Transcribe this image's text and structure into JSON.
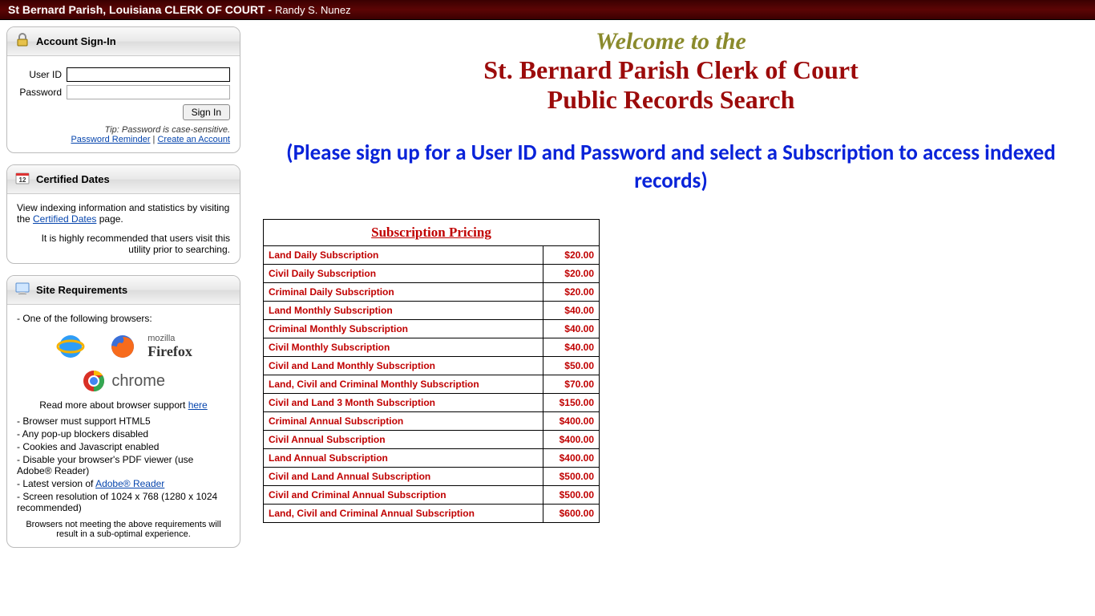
{
  "header": {
    "title": "St Bernard Parish, Louisiana CLERK OF COURT - ",
    "subtitle": "Randy S. Nunez"
  },
  "signin_panel": {
    "title": "Account Sign-In",
    "user_label": "User ID",
    "password_label": "Password",
    "button": "Sign In",
    "tip": "Tip: Password is case-sensitive.",
    "reminder_link": "Password Reminder",
    "separator": " | ",
    "create_link": "Create an Account"
  },
  "certified_panel": {
    "title": "Certified Dates",
    "text_pre": "View indexing information and statistics by visiting the ",
    "link": "Certified Dates",
    "text_post": " page.",
    "recommend": "It is highly recommended that users visit this utility prior to searching."
  },
  "requirements_panel": {
    "title": "Site Requirements",
    "intro": "- One of the following browsers:",
    "firefox_small": "mozilla",
    "firefox_big": "Firefox",
    "chrome_label": "chrome",
    "support_text": "Read more about browser support ",
    "support_link": "here",
    "items": [
      "- Browser must support HTML5",
      "- Any pop-up blockers disabled",
      "- Cookies and Javascript enabled",
      "- Disable your browser's PDF viewer (use Adobe® Reader)",
      "- Latest version of ",
      "- Screen resolution of 1024 x 768 (1280 x 1024 recommended)"
    ],
    "adobe_link": "Adobe® Reader",
    "note": "Browsers not meeting the above requirements will result in a sub-optimal experience."
  },
  "welcome": {
    "pre": "Welcome to the",
    "line1": "St. Bernard Parish Clerk of Court",
    "line2": "Public Records Search"
  },
  "signup_note": "(Please sign up for a User ID and Password and select a Subscription to access indexed records)",
  "pricing": {
    "heading": "Subscription Pricing",
    "rows": [
      {
        "name": "Land Daily Subscription",
        "price": "$20.00"
      },
      {
        "name": "Civil Daily Subscription",
        "price": "$20.00"
      },
      {
        "name": "Criminal Daily Subscription",
        "price": "$20.00"
      },
      {
        "name": "Land Monthly Subscription",
        "price": "$40.00"
      },
      {
        "name": "Criminal Monthly Subscription",
        "price": "$40.00"
      },
      {
        "name": "Civil Monthly Subscription",
        "price": "$40.00"
      },
      {
        "name": "Civil and Land Monthly Subscription",
        "price": "$50.00"
      },
      {
        "name": "Land, Civil and Criminal Monthly Subscription",
        "price": "$70.00"
      },
      {
        "name": "Civil and Land 3 Month Subscription",
        "price": "$150.00"
      },
      {
        "name": "Criminal Annual Subscription",
        "price": "$400.00"
      },
      {
        "name": "Civil Annual Subscription",
        "price": "$400.00"
      },
      {
        "name": "Land Annual Subscription",
        "price": "$400.00"
      },
      {
        "name": "Civil and Land Annual Subscription",
        "price": "$500.00"
      },
      {
        "name": "Civil and Criminal Annual Subscription",
        "price": "$500.00"
      },
      {
        "name": "Land, Civil and Criminal Annual Subscription",
        "price": "$600.00"
      }
    ]
  }
}
